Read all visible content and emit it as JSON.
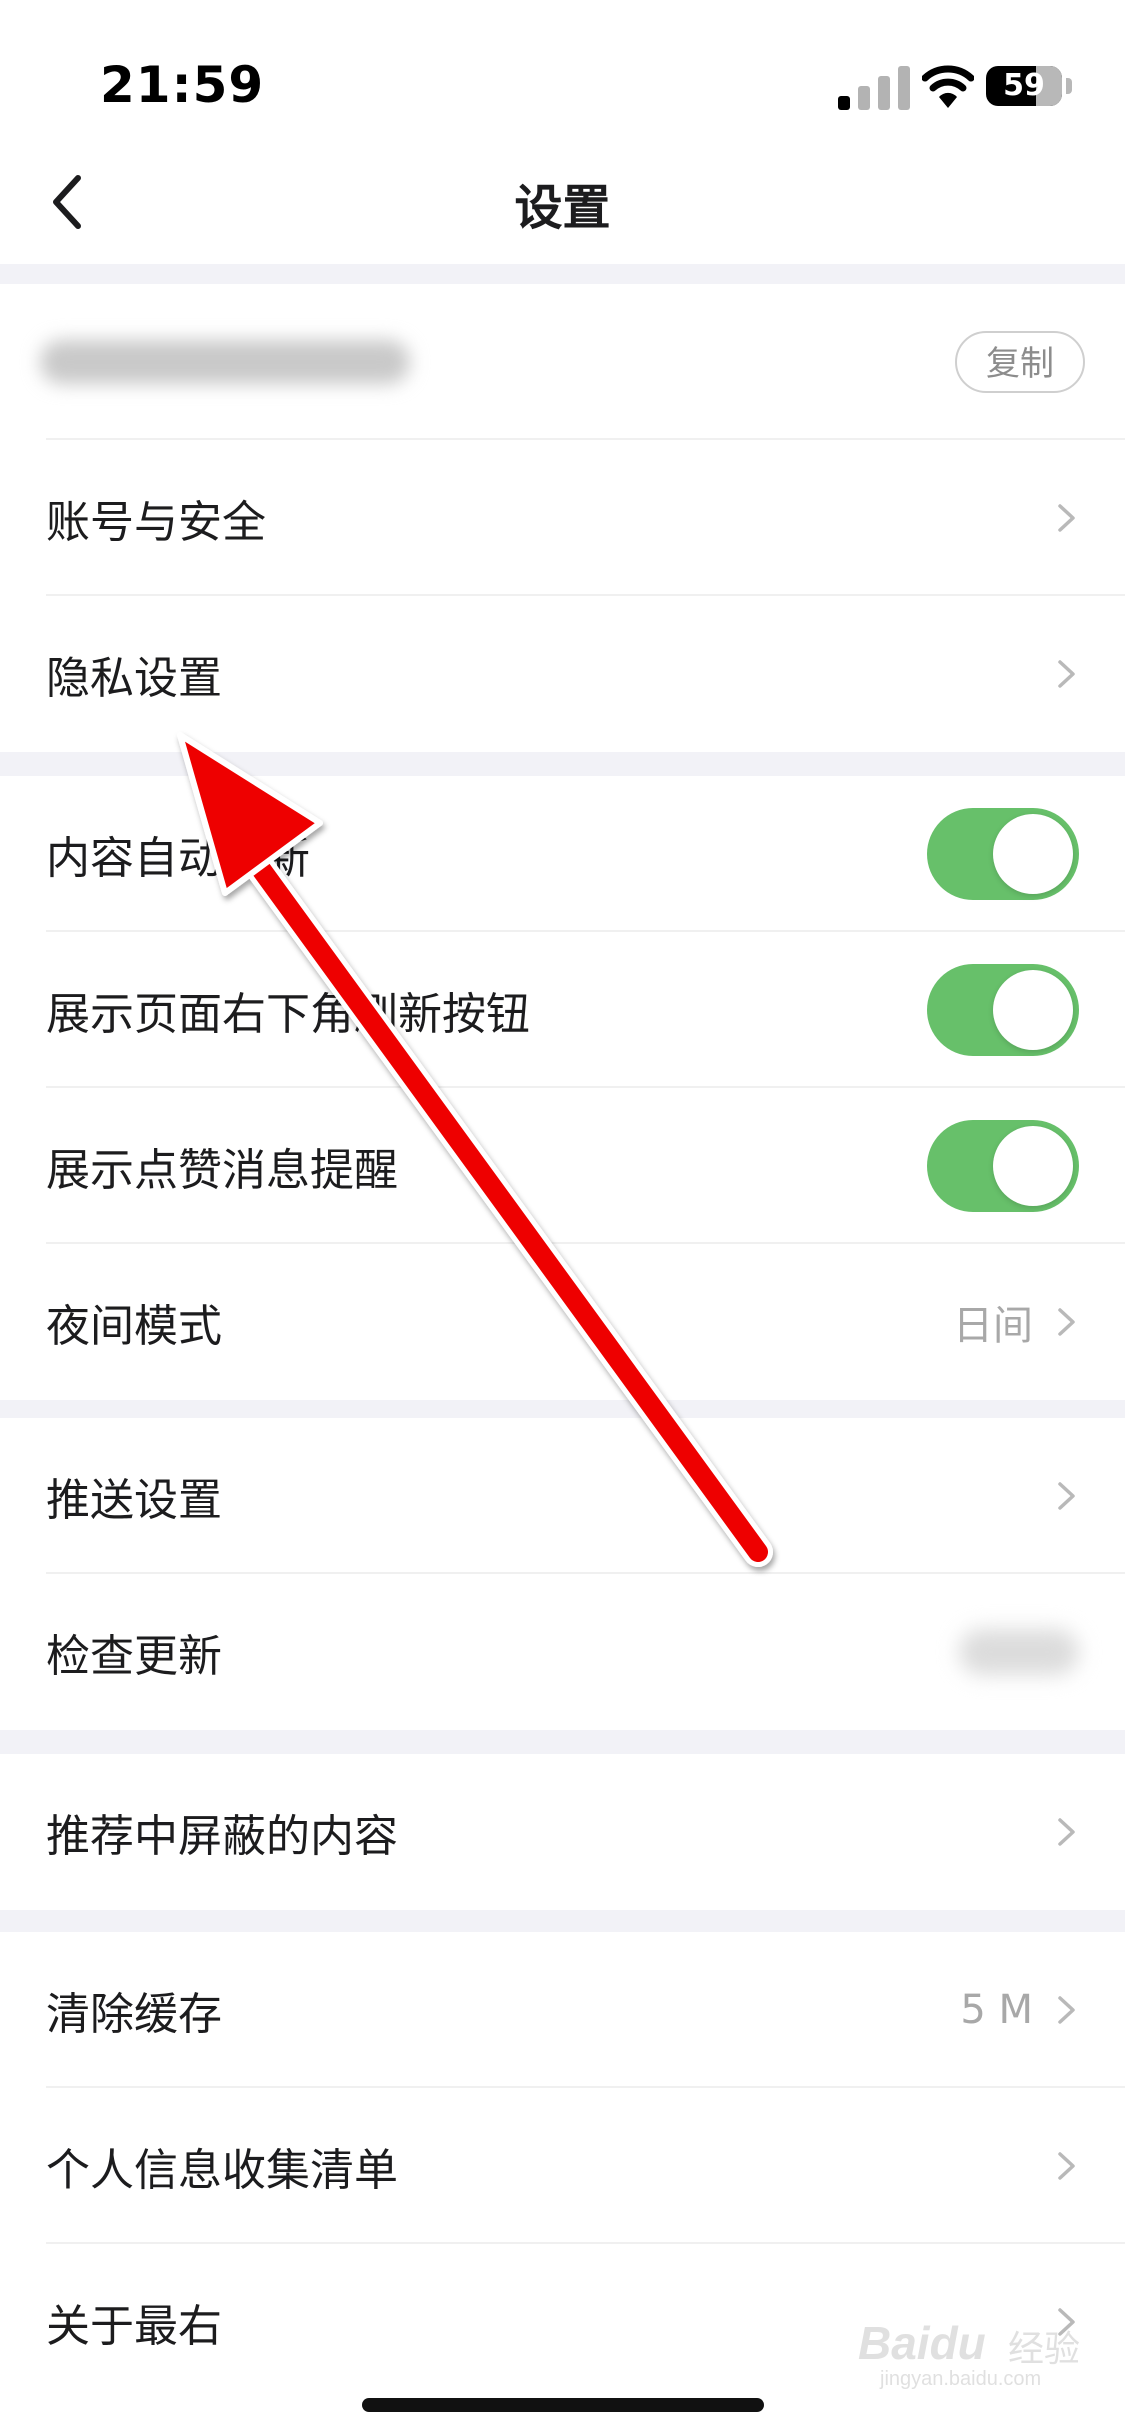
{
  "status_bar": {
    "time": "21:59",
    "battery_level": "59",
    "icons": [
      "signal-icon",
      "wifi-icon",
      "battery-icon"
    ]
  },
  "nav": {
    "title": "设置",
    "back_icon": "back-chevron-icon"
  },
  "account_group": {
    "copy_label": "复制",
    "items": [
      {
        "label": "账号与安全"
      },
      {
        "label": "隐私设置"
      }
    ]
  },
  "display_group": {
    "items": [
      {
        "label": "内容自动刷新",
        "toggle_on": true
      },
      {
        "label": "展示页面右下角刷新按钮",
        "toggle_on": true
      },
      {
        "label": "展示点赞消息提醒",
        "toggle_on": true
      },
      {
        "label": "夜间模式",
        "value": "日间"
      }
    ]
  },
  "push_group": {
    "items": [
      {
        "label": "推送设置"
      },
      {
        "label": "检查更新"
      }
    ]
  },
  "blocked_group": {
    "items": [
      {
        "label": "推荐中屏蔽的内容"
      }
    ]
  },
  "misc_group": {
    "items": [
      {
        "label": "清除缓存",
        "value": "5 M"
      },
      {
        "label": "个人信息收集清单"
      },
      {
        "label": "关于最右"
      }
    ]
  },
  "watermark": {
    "brand": "Baidu",
    "cn": "经验",
    "url": "jingyan.baidu.com"
  },
  "colors": {
    "toggle_on": "#67c06a",
    "arrow": "#ee0000",
    "background": "#f2f2f7"
  }
}
